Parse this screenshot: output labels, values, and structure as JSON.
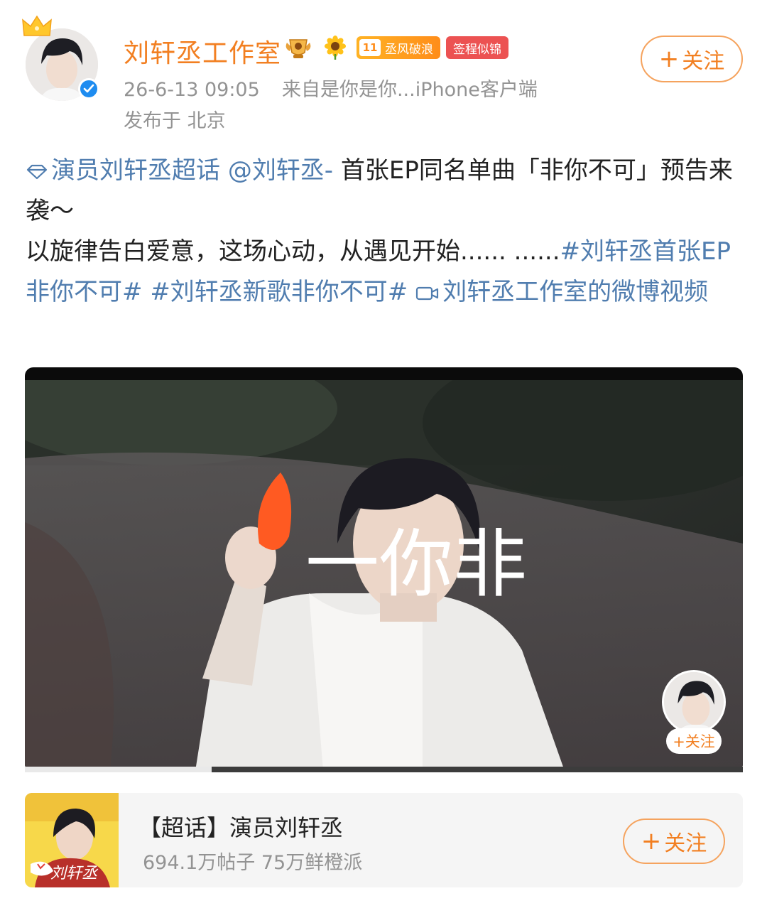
{
  "header": {
    "name": "刘轩丞工作室",
    "fan_badge_level": "11",
    "fan_badge_text": "丞风破浪",
    "tag_badge": "签程似锦",
    "timestamp": "26-6-13 09:05",
    "source": "来自是你是你...iPhone客户端",
    "location": "发布于 北京",
    "follow_label": "关注"
  },
  "post": {
    "supertopic": "演员刘轩丞超话",
    "mention": "@刘轩丞-",
    "text1": " 首张EP同名单曲「非你不可」预告来袭～",
    "text2": " 以旋律告白爱意，这场心动，从遇见开始...... ......",
    "hashtag1": "#刘轩丞首张EP非你不可#",
    "hashtag2": "#刘轩丞新歌非你不可#",
    "video_link": "刘轩丞工作室的微博视频"
  },
  "video": {
    "overlay_text": "一你非",
    "progress": 0.26,
    "pip_follow_label": "+关注"
  },
  "card": {
    "title": "【超话】演员刘轩丞",
    "stats": "694.1万帖子 75万鲜橙派",
    "follow_label": "关注",
    "thumb_text": "刘轩丞"
  },
  "colors": {
    "accent_orange": "#f27f21",
    "link_blue": "#507daf",
    "meta_gray": "#939393",
    "verify_blue": "#1e8cf0"
  },
  "icons": [
    "crown-icon",
    "verified-icon",
    "trophy-badge-icon",
    "sunflower-icon",
    "diamond-icon",
    "video-icon"
  ]
}
